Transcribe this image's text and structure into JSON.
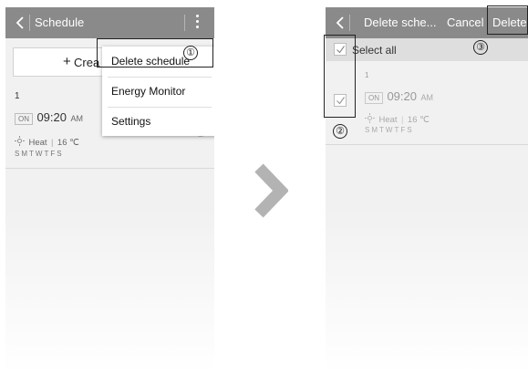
{
  "left": {
    "title": "Schedule",
    "create_label": "Crea",
    "plus": "+",
    "schedule": {
      "number": "1",
      "on_badge": "ON",
      "time": "09:20",
      "ampm": "AM",
      "mode": "Heat",
      "temp": "16 ℃",
      "days": "SMTWTFS",
      "toggle_on": false
    },
    "menu": {
      "items": [
        "Delete schedule",
        "Energy Monitor",
        "Settings"
      ]
    }
  },
  "right": {
    "title": "Delete sche...",
    "cancel_label": "Cancel",
    "delete_label": "Delete",
    "select_all_label": "Select all",
    "schedule": {
      "number": "1",
      "on_badge": "ON",
      "time": "09:20",
      "ampm": "AM",
      "mode": "Heat",
      "temp": "16 ℃",
      "days": "SMTWTFS"
    }
  },
  "callouts": [
    "①",
    "②",
    "③"
  ],
  "colors": {
    "appbar": "#8a8a8a",
    "screen_bg": "#f1f1f1",
    "arrow": "#b3b3b3"
  }
}
